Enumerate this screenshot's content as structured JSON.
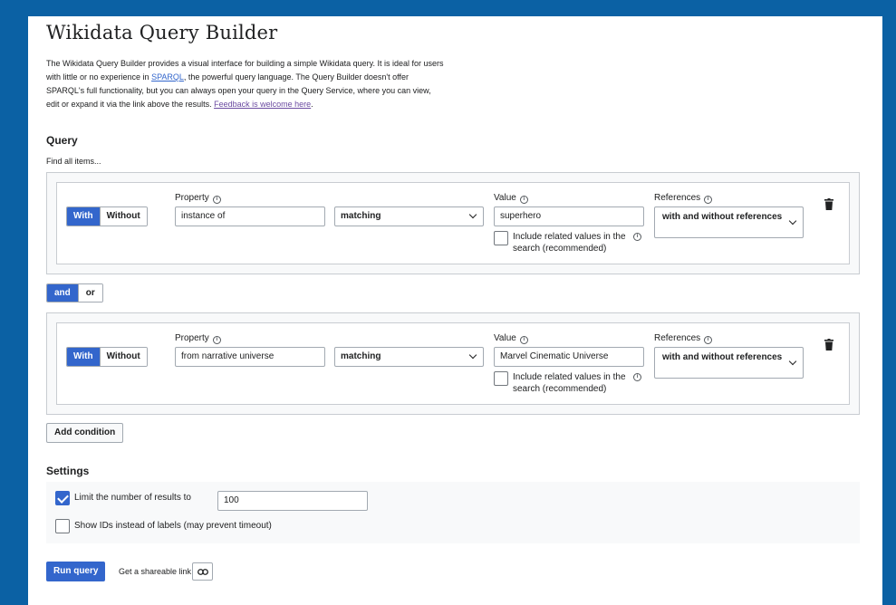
{
  "title": "Wikidata Query Builder",
  "intro": {
    "part1": "The Wikidata Query Builder provides a visual interface for building a simple Wikidata query. It is ideal for users with little or no experience in ",
    "sparql_link": "SPARQL",
    "part2": ", the powerful query language. The Query Builder doesn't offer SPARQL's full functionality, but you can always open your query in the Query Service, where you can view, edit or expand it via the link above the results. ",
    "feedback_link": "Feedback is welcome here",
    "part3": "."
  },
  "query": {
    "heading": "Query",
    "find_all": "Find all items...",
    "conditions": [
      {
        "with_label": "With",
        "without_label": "Without",
        "property_label": "Property",
        "property_value": "instance of",
        "matching": "matching",
        "value_label": "Value",
        "value": "superhero",
        "include_related": "Include related values in the search (recommended)",
        "references_label": "References",
        "references_value": "with and without references"
      },
      {
        "with_label": "With",
        "without_label": "Without",
        "property_label": "Property",
        "property_value": "from narrative universe",
        "matching": "matching",
        "value_label": "Value",
        "value": "Marvel Cinematic Universe",
        "include_related": "Include related values in the search (recommended)",
        "references_label": "References",
        "references_value": "with and without references"
      }
    ],
    "and_label": "and",
    "or_label": "or",
    "add_condition": "Add condition"
  },
  "settings": {
    "heading": "Settings",
    "limit_label": "Limit the number of results to",
    "limit_value": "100",
    "limit_checked": true,
    "show_ids_label": "Show IDs instead of labels (may prevent timeout)",
    "show_ids_checked": false
  },
  "footer": {
    "run_query": "Run query",
    "shareable_link": "Get a shareable link"
  },
  "colors": {
    "background": "#0b61a4",
    "accent": "#3366cc"
  }
}
